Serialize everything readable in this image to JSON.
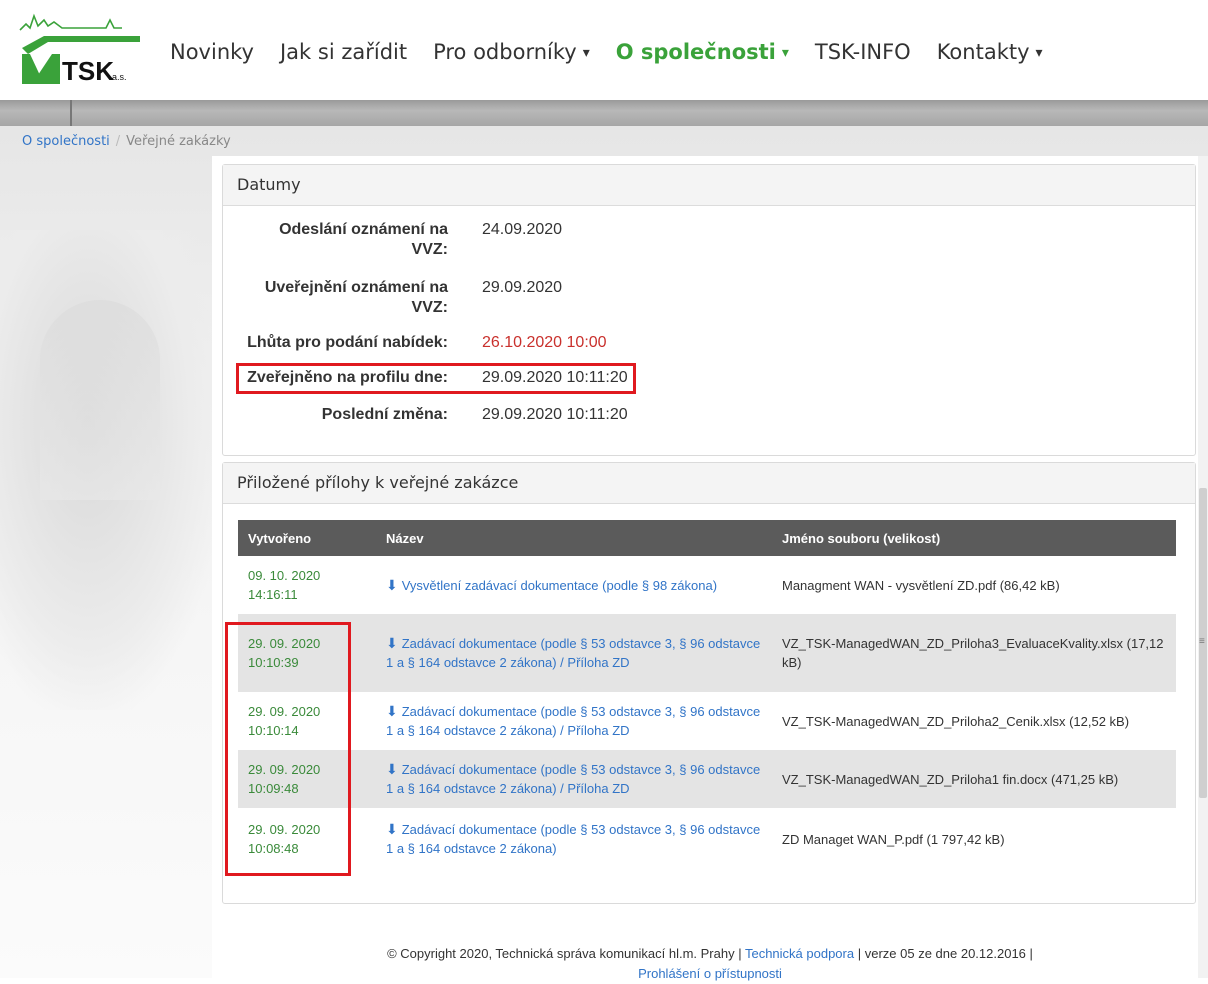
{
  "logo": {
    "text": "TSK",
    "suffix": "a.s."
  },
  "nav": [
    {
      "label": "Novinky",
      "dropdown": false,
      "active": false
    },
    {
      "label": "Jak si zařídit",
      "dropdown": false,
      "active": false
    },
    {
      "label": "Pro odborníky",
      "dropdown": true,
      "active": false
    },
    {
      "label": "O společnosti",
      "dropdown": true,
      "active": true
    },
    {
      "label": "TSK-INFO",
      "dropdown": false,
      "active": false
    },
    {
      "label": "Kontakty",
      "dropdown": true,
      "active": false
    }
  ],
  "breadcrumb": {
    "link": "O společnosti",
    "separator": "/",
    "current": "Veřejné zakázky"
  },
  "dates_panel": {
    "title": "Datumy",
    "rows": [
      {
        "label": "Odeslání oznámení na VVZ:",
        "value": "24.09.2020"
      },
      {
        "label": "Uveřejnění oznámení na VVZ:",
        "value": "29.09.2020"
      },
      {
        "label": "Lhůta pro podání nabídek:",
        "value": "26.10.2020 10:00"
      },
      {
        "label": "Zveřejněno na profilu dne:",
        "value": "29.09.2020 10:11:20"
      },
      {
        "label": "Poslední změna:",
        "value": "29.09.2020 10:11:20"
      }
    ]
  },
  "attachments_panel": {
    "title": "Přiložené přílohy k veřejné zakázce",
    "columns": [
      "Vytvořeno",
      "Název",
      "Jméno souboru (velikost)"
    ],
    "rows": [
      {
        "date": "09. 10. 2020",
        "time": "14:16:11",
        "name": "Vysvětlení zadávací dokumentace (podle § 98 zákona)",
        "file": "Managment WAN - vysvětlení ZD.pdf (86,42 kB)"
      },
      {
        "date": "29. 09. 2020",
        "time": "10:10:39",
        "name": "Zadávací dokumentace (podle § 53 odstavce 3, § 96 odstavce 1 a § 164 odstavce 2 zákona) / Příloha ZD",
        "file": "VZ_TSK-ManagedWAN_ZD_Priloha3_EvaluaceKvality.xlsx (17,12 kB)"
      },
      {
        "date": "29. 09. 2020",
        "time": "10:10:14",
        "name": "Zadávací dokumentace (podle § 53 odstavce 3, § 96 odstavce 1 a § 164 odstavce 2 zákona) / Příloha ZD",
        "file": "VZ_TSK-ManagedWAN_ZD_Priloha2_Cenik.xlsx (12,52 kB)"
      },
      {
        "date": "29. 09. 2020",
        "time": "10:09:48",
        "name": "Zadávací dokumentace (podle § 53 odstavce 3, § 96 odstavce 1 a § 164 odstavce 2 zákona) / Příloha ZD",
        "file": "VZ_TSK-ManagedWAN_ZD_Priloha1 fin.docx (471,25 kB)"
      },
      {
        "date": "29. 09. 2020",
        "time": "10:08:48",
        "name": "Zadávací dokumentace (podle § 53 odstavce 3, § 96 odstavce 1 a § 164 odstavce 2 zákona)",
        "file": "ZD Managet WAN_P.pdf (1 797,42 kB)"
      }
    ]
  },
  "footer": {
    "copyright": "© Copyright 2020, Technická správa komunikací hl.m. Prahy |",
    "support_link": "Technická podpora",
    "version": "| verze 05 ze dne 20.12.2016 |",
    "accessibility_link": "Prohlášení o přístupnosti"
  },
  "colors": {
    "accent_green": "#3aa23a",
    "link_blue": "#3174c7",
    "deadline_red": "#c9302c",
    "highlight_red": "#e0191f",
    "table_header": "#5b5b5b"
  },
  "icons": {
    "download": "download-icon",
    "caret": "chevron-down-icon"
  }
}
